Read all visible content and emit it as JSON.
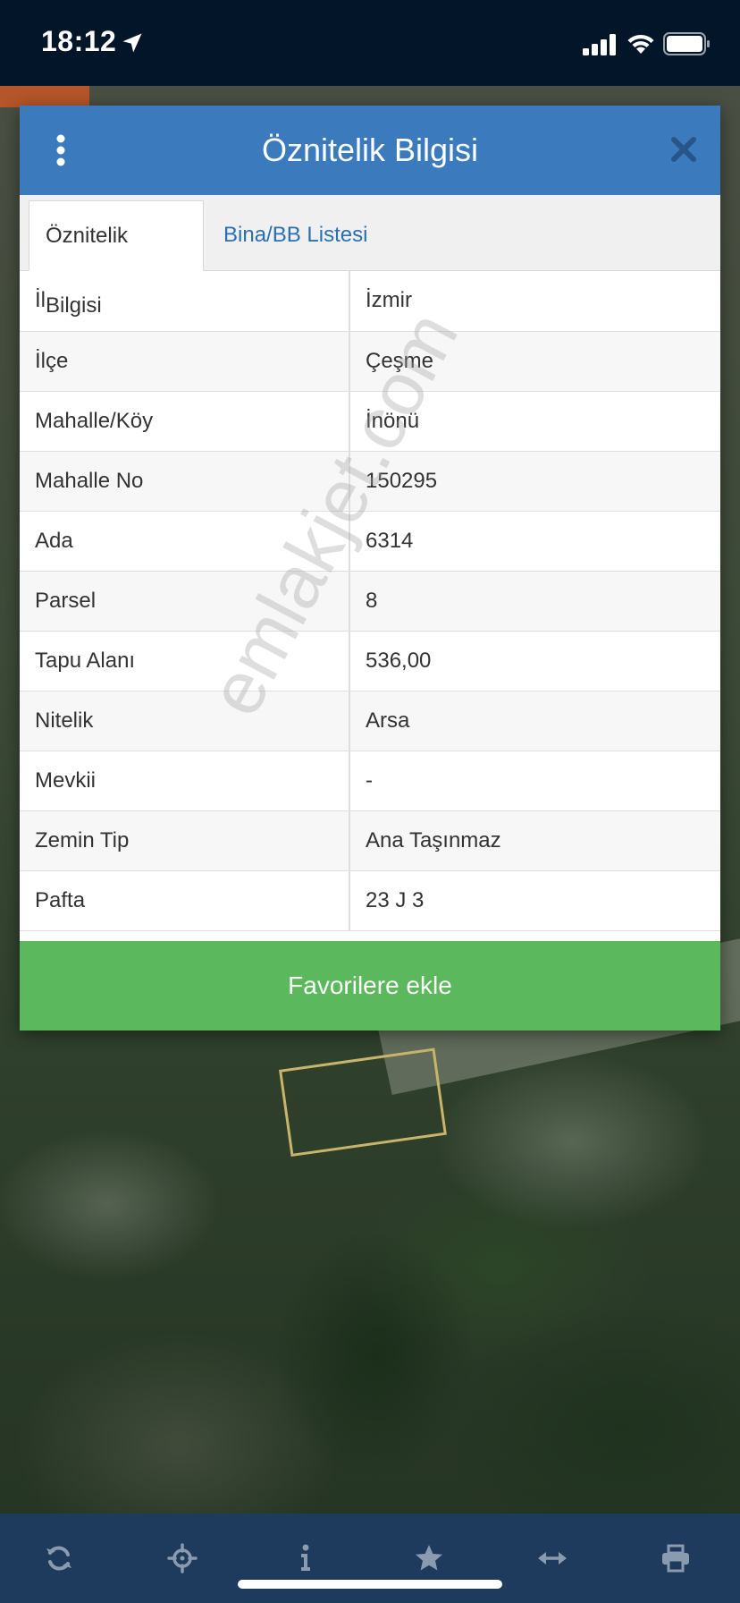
{
  "status_bar": {
    "time": "18:12",
    "icons": [
      "location-arrow-icon",
      "cellular-signal-icon",
      "wifi-icon",
      "battery-icon"
    ]
  },
  "dialog": {
    "title": "Öznitelik Bilgisi",
    "menu_icon": "vertical-dots-icon",
    "close_icon": "close-icon",
    "tabs": [
      {
        "label": "Öznitelik Bilgisi",
        "active": true
      },
      {
        "label": "Bina/BB Listesi",
        "active": false
      }
    ],
    "rows": [
      {
        "key": "İl",
        "value": "İzmir"
      },
      {
        "key": "İlçe",
        "value": "Çeşme"
      },
      {
        "key": "Mahalle/Köy",
        "value": "İnönü"
      },
      {
        "key": "Mahalle No",
        "value": "150295"
      },
      {
        "key": "Ada",
        "value": "6314"
      },
      {
        "key": "Parsel",
        "value": "8"
      },
      {
        "key": "Tapu Alanı",
        "value": "536,00"
      },
      {
        "key": "Nitelik",
        "value": "Arsa"
      },
      {
        "key": "Mevkii",
        "value": "-"
      },
      {
        "key": "Zemin Tip",
        "value": "Ana Taşınmaz"
      },
      {
        "key": "Pafta",
        "value": "23 J 3"
      }
    ],
    "favorite_button": "Favorilere ekle"
  },
  "watermark": "emlakjet.com",
  "toolbar": {
    "icons": [
      "refresh-icon",
      "crosshair-icon",
      "info-icon",
      "star-icon",
      "measure-icon",
      "print-icon"
    ]
  },
  "colors": {
    "header_blue": "#3b7bbd",
    "tab_link_blue": "#2a6fb3",
    "button_green": "#5cb85c",
    "status_bar_bg": "#021529",
    "toolbar_bg": "#1e3a5c"
  }
}
